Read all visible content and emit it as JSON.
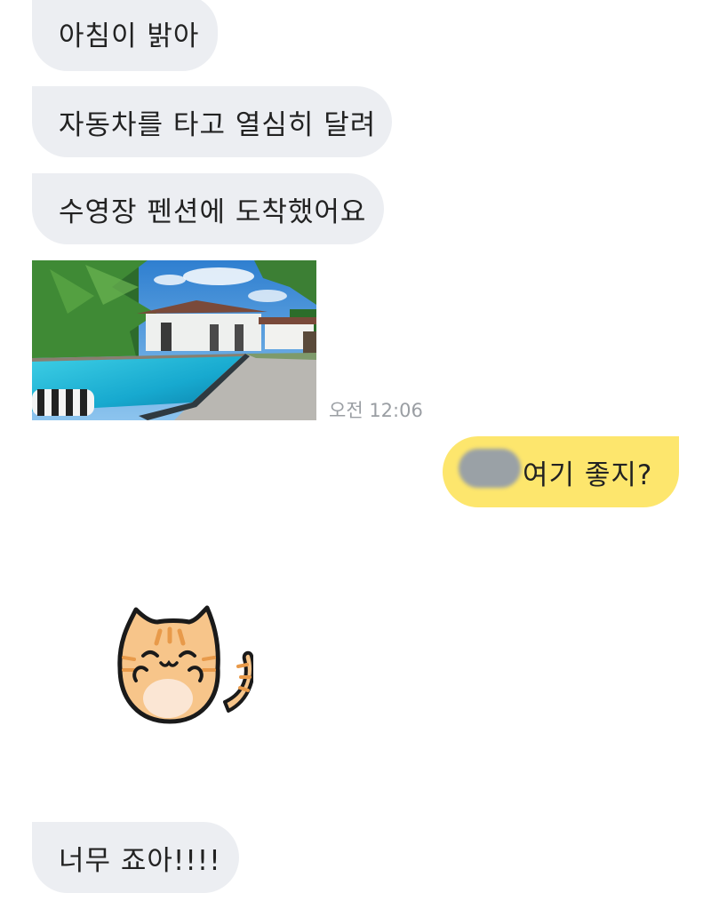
{
  "messages": {
    "m1": "아침이 밝아",
    "m2": "자동차를 타고 열심히 달려",
    "m3": "수영장 펜션에 도착했어요",
    "m4_time": "오전 12:06",
    "m5": "여기 좋지?",
    "m7": "너무 죠아!!!!"
  },
  "colors": {
    "received_bubble": "#eceef2",
    "sent_bubble": "#fde66d",
    "timestamp": "#9a9ea3"
  },
  "icons": {
    "sticker": "cat-sticker-icon"
  }
}
